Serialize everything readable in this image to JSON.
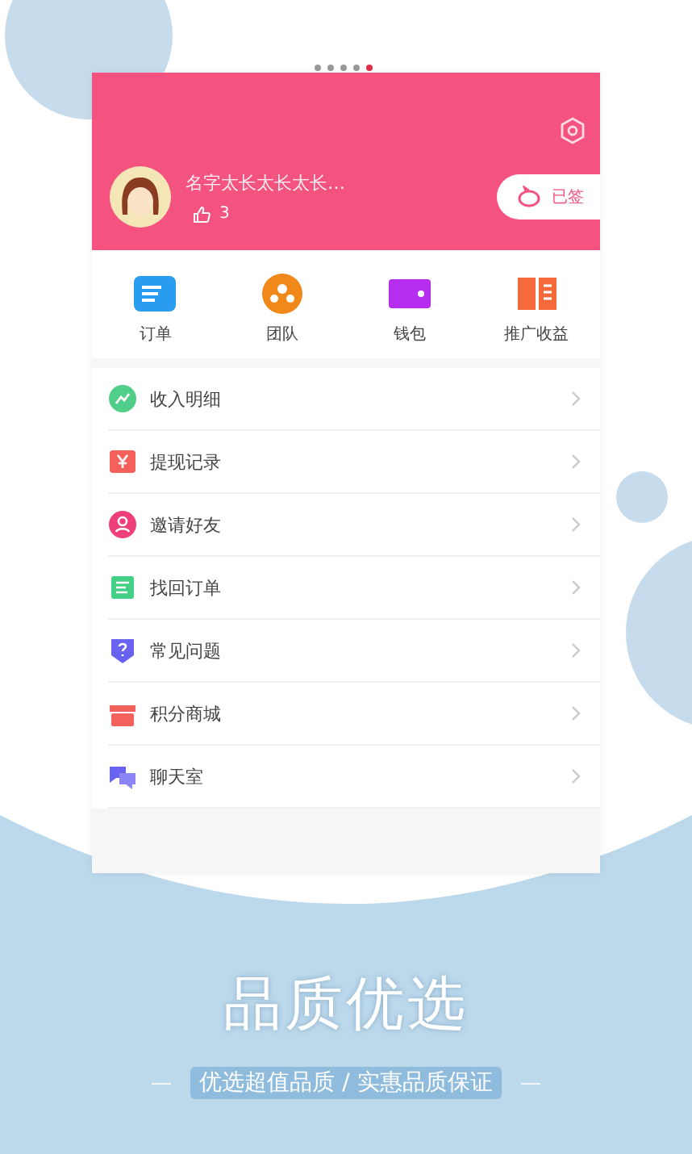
{
  "pager": [
    {
      "selected": false
    },
    {
      "selected": false
    },
    {
      "selected": false
    },
    {
      "selected": false
    },
    {
      "selected": true
    }
  ],
  "profile": {
    "name": "名字太长太长太长…",
    "likes": "3",
    "checkin": "已签"
  },
  "shortcuts": [
    {
      "label": "订单",
      "kind": "order"
    },
    {
      "label": "团队",
      "kind": "team"
    },
    {
      "label": "钱包",
      "kind": "wallet"
    },
    {
      "label": "推广收益",
      "kind": "book"
    }
  ],
  "menu": [
    {
      "label": "收入明细",
      "kind": "income"
    },
    {
      "label": "提现记录",
      "kind": "withdraw"
    },
    {
      "label": "邀请好友",
      "kind": "invite"
    },
    {
      "label": "找回订单",
      "kind": "order"
    },
    {
      "label": "常见问题",
      "kind": "faq"
    },
    {
      "label": "积分商城",
      "kind": "shop"
    },
    {
      "label": "聊天室",
      "kind": "chat"
    }
  ],
  "slogan": {
    "title": "品质优选",
    "subtitle": "优选超值品质 / 实惠品质保证"
  }
}
